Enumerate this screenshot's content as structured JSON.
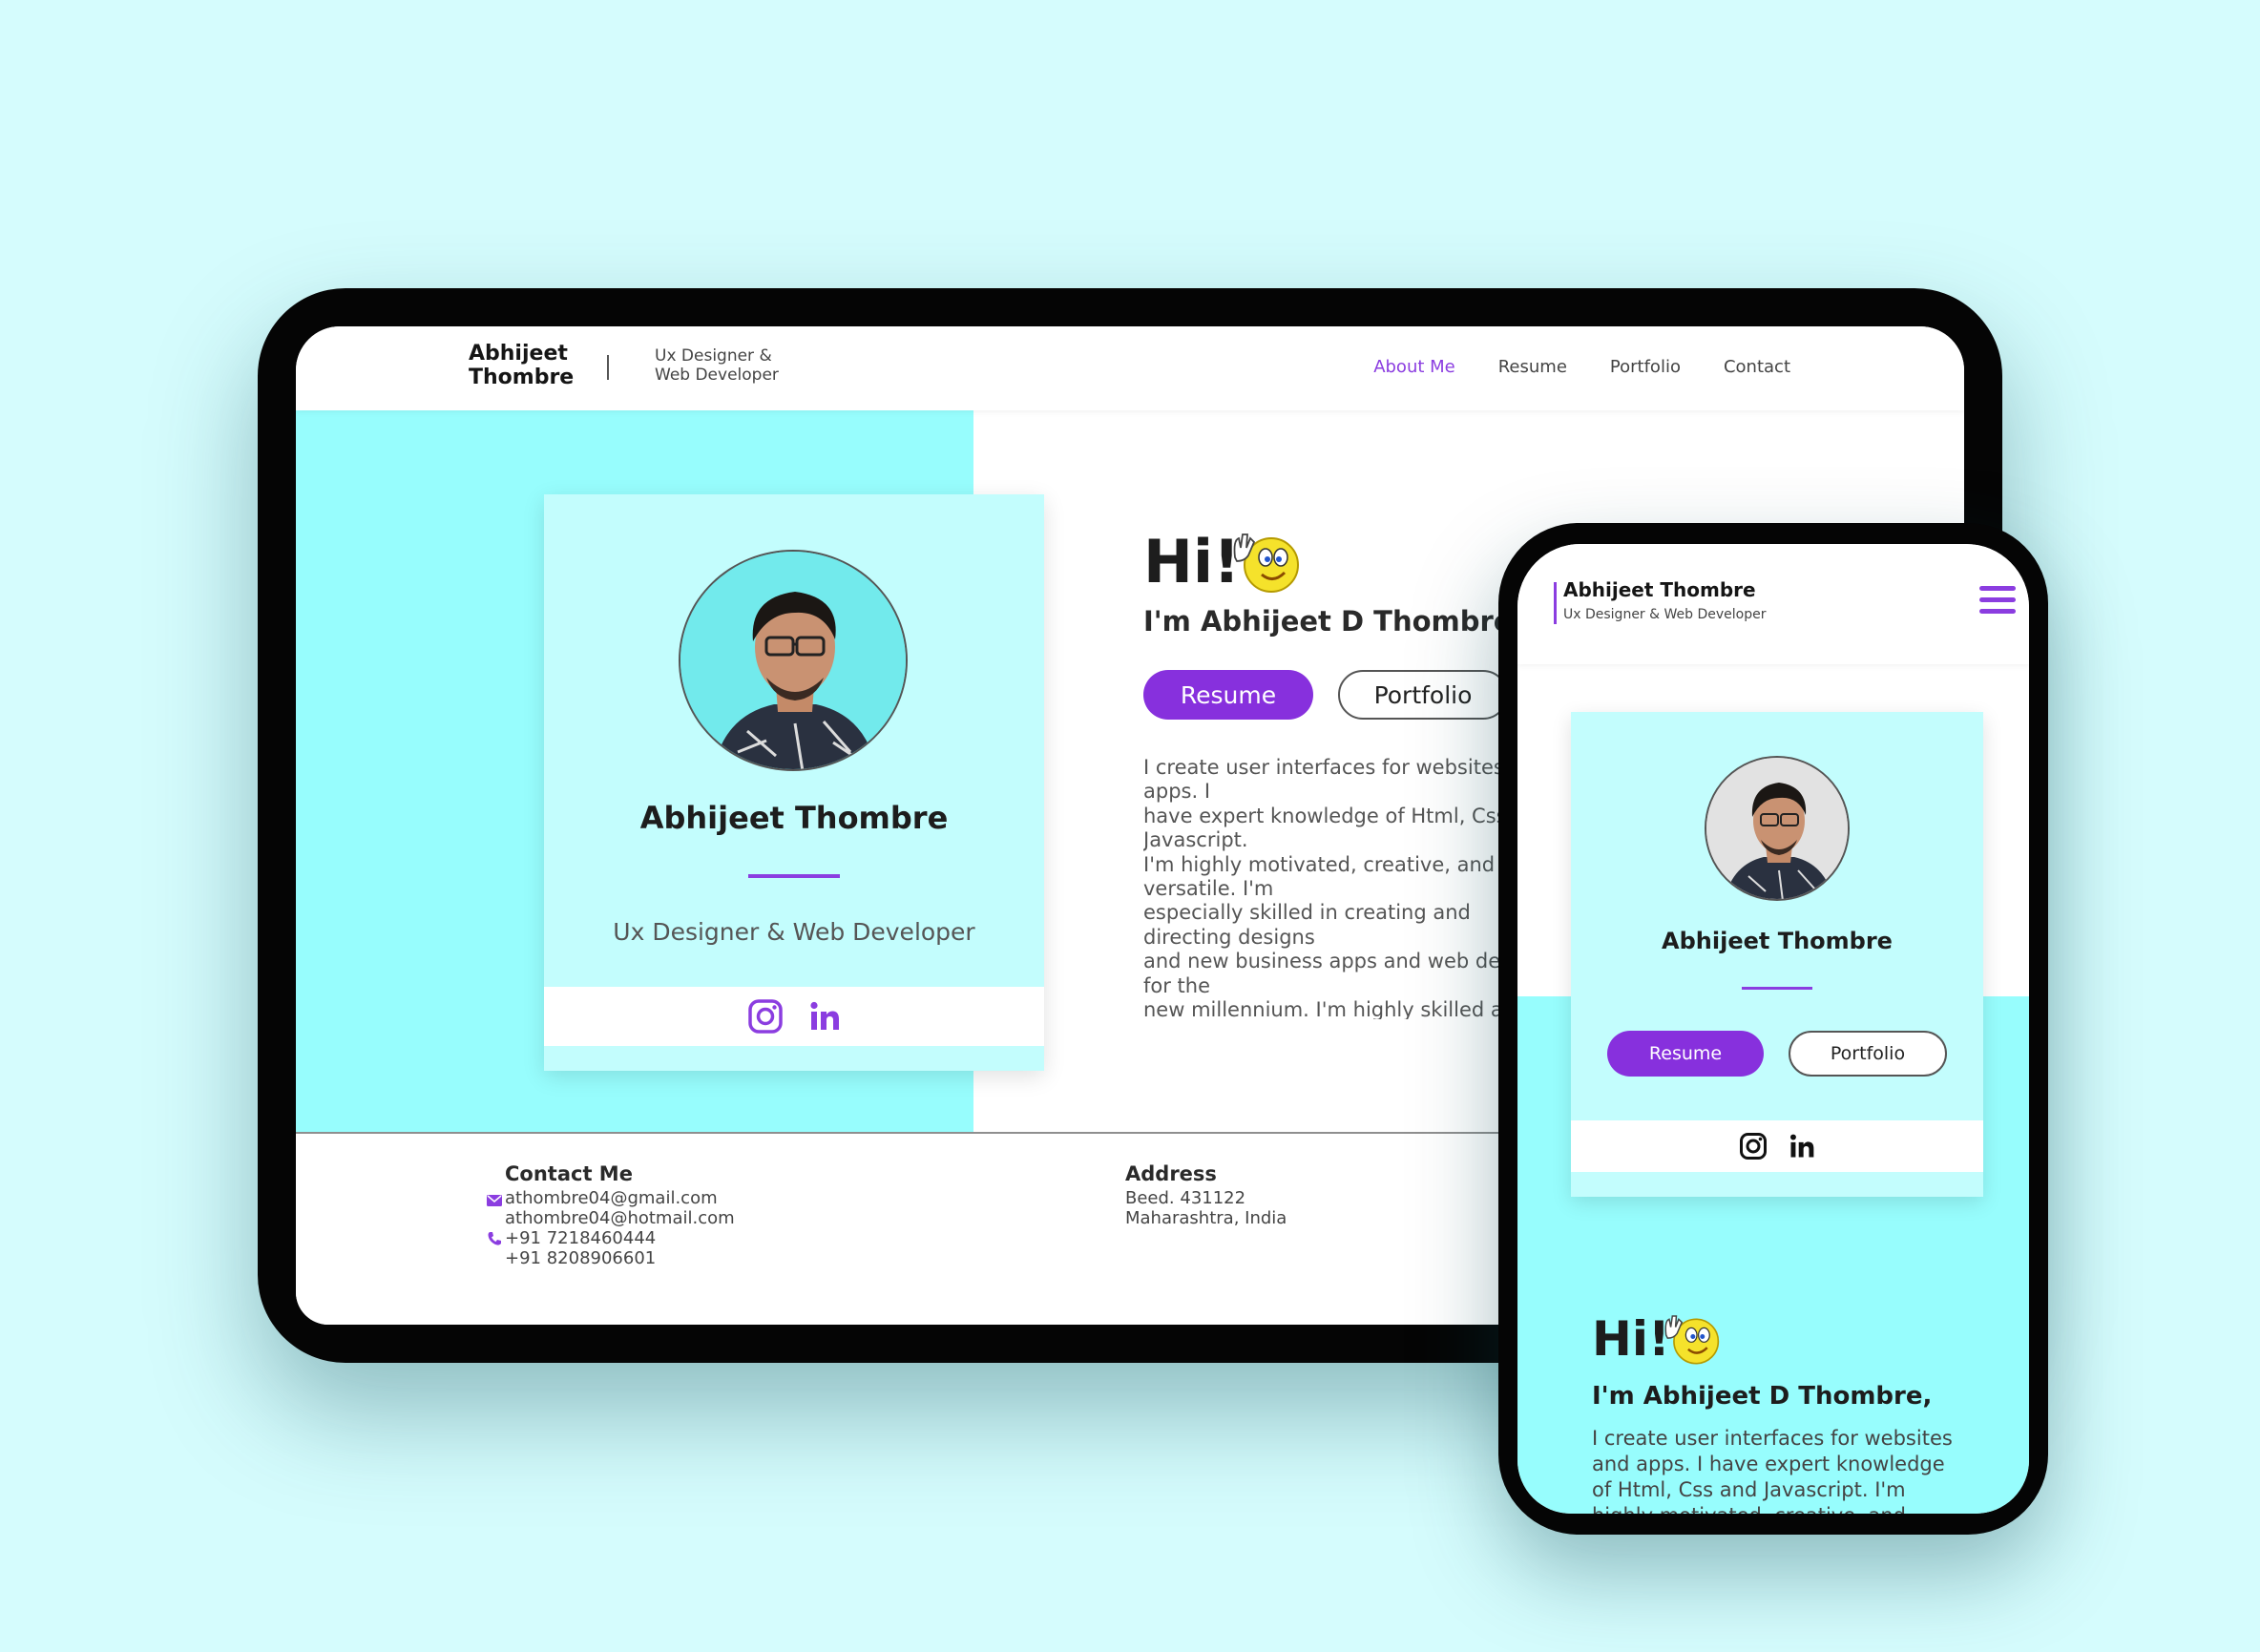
{
  "colors": {
    "page_bg": "#d5fcfd",
    "accent": "#8b3de0",
    "cyan": "#97fdfd",
    "card": "#c3fdfd"
  },
  "tablet": {
    "nav": {
      "brand_name": "Abhijeet Thombre",
      "brand_role": "Ux Designer & Web Developer",
      "menu": [
        "About Me",
        "Resume",
        "Portfolio",
        "Contact"
      ],
      "active_menu": "About Me"
    },
    "card": {
      "name": "Abhijeet Thombre",
      "role": "Ux Designer & Web Developer",
      "icons": [
        "instagram-icon",
        "linkedin-icon"
      ]
    },
    "hero": {
      "greeting": "Hi!",
      "intro": "I'm Abhijeet D Thombre,",
      "resume_button": "Resume",
      "portfolio_button": "Portfolio",
      "bio": "I create user interfaces for websites and apps. I\nhave expert knowledge of Html, Css and Javascript.\nI'm highly motivated, creative, and versatile. I'm\nespecially skilled in creating and directing designs\nand new business apps and web design for the\nnew millennium. I'm highly skilled at interactive\nexperience for the web and mobile apps. I\nhave exceptional interpersonal skills with team\nmembers and subordinates. I am proficient at\nincorporating the desires of the client into a\nsuperior design solution."
    },
    "footer": {
      "contact_title": "Contact Me",
      "emails": [
        "athombre04@gmail.com",
        "athombre04@hotmail.com"
      ],
      "phones": [
        "+91 7218460444",
        "+91 8208906601"
      ],
      "address_title": "Address",
      "address_lines": [
        "Beed. 431122",
        "Maharashtra, India"
      ]
    }
  },
  "phone": {
    "header": {
      "brand_name": "Abhijeet Thombre",
      "brand_role": "Ux Designer & Web Developer"
    },
    "card": {
      "name": "Abhijeet Thombre",
      "resume_button": "Resume",
      "portfolio_button": "Portfolio"
    },
    "hero": {
      "greeting": "Hi!",
      "intro": "I'm Abhijeet D Thombre,",
      "bio": "I create user interfaces for websites\nand apps. I have expert knowledge\nof Html, Css and Javascript. I'm\nhighly motivated, creative, and\nversatile. I'm especially skilled in"
    }
  }
}
